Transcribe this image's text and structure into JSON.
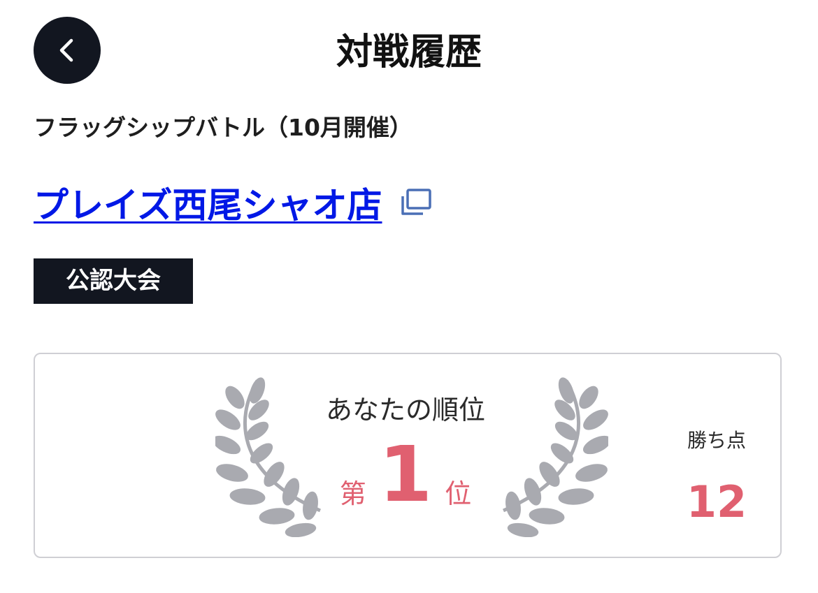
{
  "header": {
    "title": "対戦履歴",
    "back_icon": "chevron-left-icon"
  },
  "event": {
    "name": "フラッグシップバトル（10月開催）",
    "store_name": "プレイズ西尾シャオ店",
    "external_icon": "open-in-new-window-icon",
    "badge": "公認大会"
  },
  "result": {
    "rank_heading": "あなたの順位",
    "rank_prefix": "第",
    "rank": "1",
    "rank_suffix": "位",
    "points_label": "勝ち点",
    "points": "12",
    "laurel_icon": "laurel-wreath-icon"
  },
  "colors": {
    "dark": "#121620",
    "link": "#0018e6",
    "accent": "#e06070",
    "laurel": "#a9aab0",
    "card_border": "#cfcfd4"
  }
}
